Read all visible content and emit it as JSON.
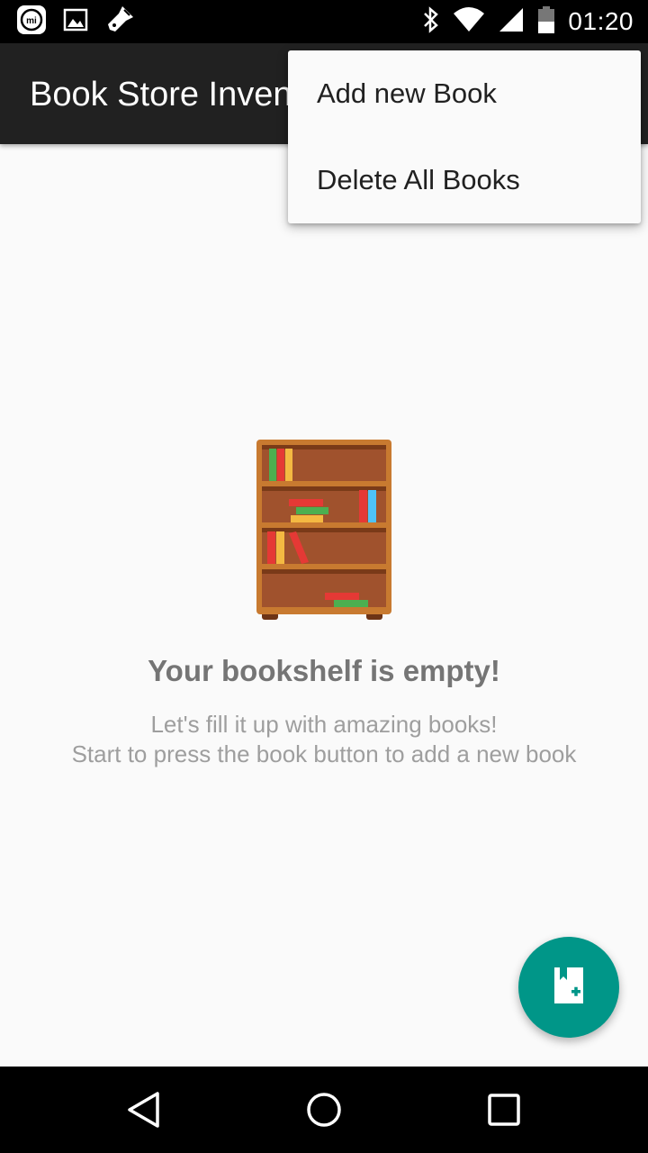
{
  "status_bar": {
    "time": "01:20",
    "left_icons": [
      "mi-notification-icon",
      "image-notification-icon",
      "flashlight-notification-icon"
    ],
    "right_icons": [
      "bluetooth-icon",
      "wifi-icon",
      "signal-icon",
      "battery-icon"
    ]
  },
  "app_bar": {
    "title": "Book Store Inventory"
  },
  "overflow_menu": {
    "items": [
      {
        "label": "Add new Book"
      },
      {
        "label": "Delete All Books"
      }
    ]
  },
  "empty_state": {
    "illustration": "bookshelf-icon",
    "title": "Your bookshelf is empty!",
    "subtitle_line1": "Let's fill it up with amazing books!",
    "subtitle_line2": "Start to press the book button to add a new book"
  },
  "fab": {
    "icon": "add-book-icon",
    "color": "#009688"
  },
  "nav_bar": {
    "buttons": [
      "back-icon",
      "home-icon",
      "recents-icon"
    ]
  },
  "colors": {
    "app_bar": "#212121",
    "accent": "#009688",
    "background": "#fafafa"
  }
}
